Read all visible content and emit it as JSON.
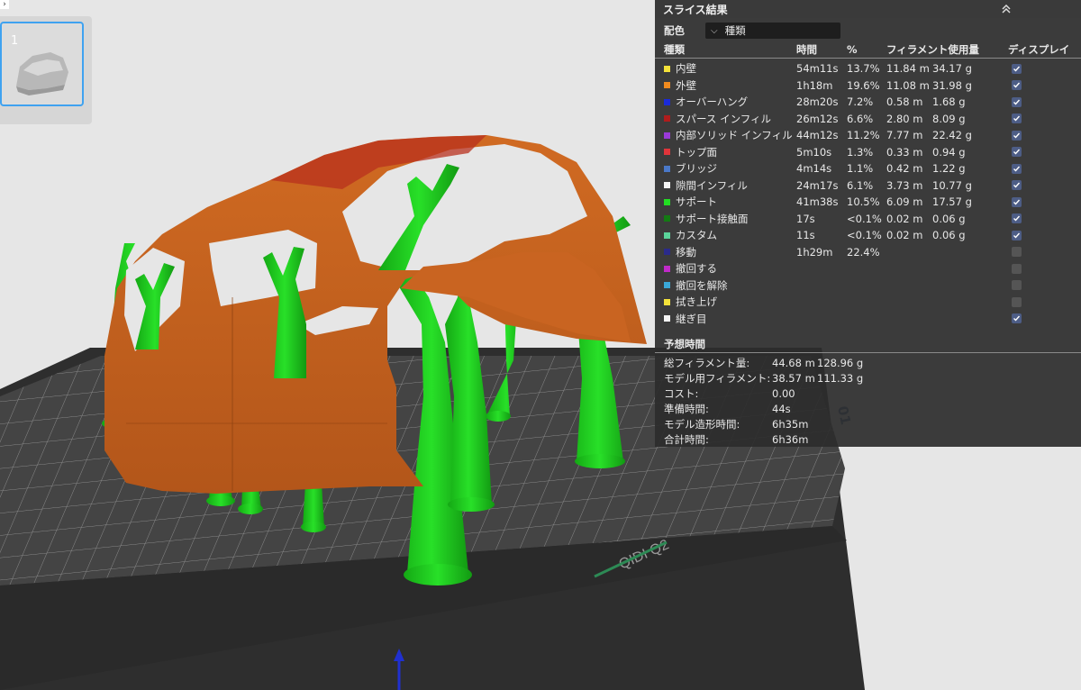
{
  "thumbnail": {
    "number": "1"
  },
  "panel": {
    "title": "スライス結果",
    "color_scheme_label": "配色",
    "color_scheme_value": "種類",
    "headers": {
      "type": "種類",
      "time": "時間",
      "percent": "%",
      "filament": "フィラメント使用量",
      "display": "ディスプレイ"
    },
    "rows": [
      {
        "color": "#f4e23a",
        "name": "内壁",
        "time": "54m11s",
        "percent": "13.7%",
        "length": "11.84 m",
        "weight": "34.17 g",
        "checked": true
      },
      {
        "color": "#f08a1e",
        "name": "外壁",
        "time": "1h18m",
        "percent": "19.6%",
        "length": "11.08 m",
        "weight": "31.98 g",
        "checked": true
      },
      {
        "color": "#1a2ad8",
        "name": "オーバーハング",
        "time": "28m20s",
        "percent": "7.2%",
        "length": "0.58 m",
        "weight": "1.68 g",
        "checked": true
      },
      {
        "color": "#b01c1c",
        "name": "スパース インフィル",
        "time": "26m12s",
        "percent": "6.6%",
        "length": "2.80 m",
        "weight": "8.09 g",
        "checked": true
      },
      {
        "color": "#9a3ad8",
        "name": "内部ソリッド インフィル",
        "time": "44m12s",
        "percent": "11.2%",
        "length": "7.77 m",
        "weight": "22.42 g",
        "checked": true
      },
      {
        "color": "#e0343a",
        "name": "トップ面",
        "time": "5m10s",
        "percent": "1.3%",
        "length": "0.33 m",
        "weight": "0.94 g",
        "checked": true
      },
      {
        "color": "#4a78c8",
        "name": "ブリッジ",
        "time": "4m14s",
        "percent": "1.1%",
        "length": "0.42 m",
        "weight": "1.22 g",
        "checked": true
      },
      {
        "color": "#f4f4f4",
        "name": "隙間インフィル",
        "time": "24m17s",
        "percent": "6.1%",
        "length": "3.73 m",
        "weight": "10.77 g",
        "checked": true
      },
      {
        "color": "#22dd22",
        "name": "サポート",
        "time": "41m38s",
        "percent": "10.5%",
        "length": "6.09 m",
        "weight": "17.57 g",
        "checked": true
      },
      {
        "color": "#137a13",
        "name": "サポート接触面",
        "time": "17s",
        "percent": "<0.1%",
        "length": "0.02 m",
        "weight": "0.06 g",
        "checked": true
      },
      {
        "color": "#5ad39a",
        "name": "カスタム",
        "time": "11s",
        "percent": "<0.1%",
        "length": "0.02 m",
        "weight": "0.06 g",
        "checked": true
      },
      {
        "color": "#2a2a8a",
        "name": "移動",
        "time": "1h29m",
        "percent": "22.4%",
        "length": "",
        "weight": "",
        "checked": false
      },
      {
        "color": "#c02ac8",
        "name": "撤回する",
        "time": "",
        "percent": "",
        "length": "",
        "weight": "",
        "checked": false
      },
      {
        "color": "#3aa8d8",
        "name": "撤回を解除",
        "time": "",
        "percent": "",
        "length": "",
        "weight": "",
        "checked": false
      },
      {
        "color": "#f4e23a",
        "name": "拭き上げ",
        "time": "",
        "percent": "",
        "length": "",
        "weight": "",
        "checked": false
      },
      {
        "color": "#f4f4f4",
        "name": "継ぎ目",
        "time": "",
        "percent": "",
        "length": "",
        "weight": "",
        "checked": true
      }
    ],
    "estimate_title": "予想時間",
    "stats": [
      {
        "label": "総フィラメント量:",
        "v1": "44.68 m",
        "v2": "128.96 g"
      },
      {
        "label": "モデル用フィラメント:",
        "v1": "38.57 m",
        "v2": "111.33 g"
      },
      {
        "label": "コスト:",
        "v1": "0.00",
        "v2": ""
      },
      {
        "label": "準備時間:",
        "v1": "44s",
        "v2": ""
      },
      {
        "label": "モデル造形時間:",
        "v1": "6h35m",
        "v2": ""
      },
      {
        "label": "合計時間:",
        "v1": "6h36m",
        "v2": ""
      }
    ]
  },
  "bed": {
    "brand": "QIDI Q2",
    "plate_number": "01"
  },
  "colors": {
    "model": "#c8621c",
    "support": "#1ecb1e",
    "bed": "#3a3a3a"
  }
}
